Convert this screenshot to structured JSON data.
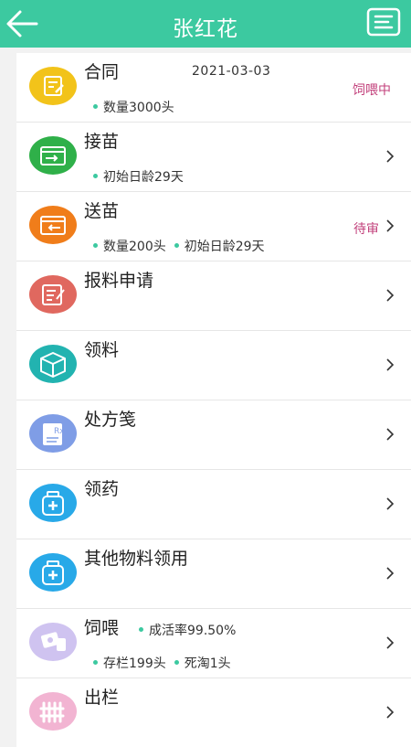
{
  "header": {
    "title": "张红花"
  },
  "colors": {
    "accent": "#3cc9a0",
    "status": "#c2407b"
  },
  "rows": [
    {
      "name": "合同",
      "date": "2021-03-03",
      "meta": [
        "数量3000头"
      ],
      "status": "饲喂中",
      "icon": "contract-icon",
      "color": "#f2c31a"
    },
    {
      "name": "接苗",
      "meta": [
        "初始日龄29天"
      ],
      "icon": "receive-box-icon",
      "color": "#2fb049"
    },
    {
      "name": "送苗",
      "meta": [
        "数量200头",
        "初始日龄29天"
      ],
      "status": "待审",
      "icon": "send-box-icon",
      "color": "#f07d1a"
    },
    {
      "name": "报料申请",
      "icon": "feed-request-icon",
      "color": "#e0685f"
    },
    {
      "name": "领料",
      "icon": "material-box-icon",
      "color": "#22b3b0"
    },
    {
      "name": "处方笺",
      "icon": "prescription-icon",
      "color": "#7f9de6"
    },
    {
      "name": "领药",
      "icon": "medicine-bottle-icon",
      "color": "#28a9e8"
    },
    {
      "name": "其他物料领用",
      "icon": "medicine-kit-icon",
      "color": "#28a9e8"
    },
    {
      "name": "饲喂",
      "meta_top": [
        "成活率99.50%"
      ],
      "meta": [
        "存栏199头",
        "死淘1头"
      ],
      "icon": "feeding-icon",
      "color": "#cfc3f0"
    },
    {
      "name": "出栏",
      "icon": "fence-icon",
      "color": "#f2b4d2"
    }
  ]
}
